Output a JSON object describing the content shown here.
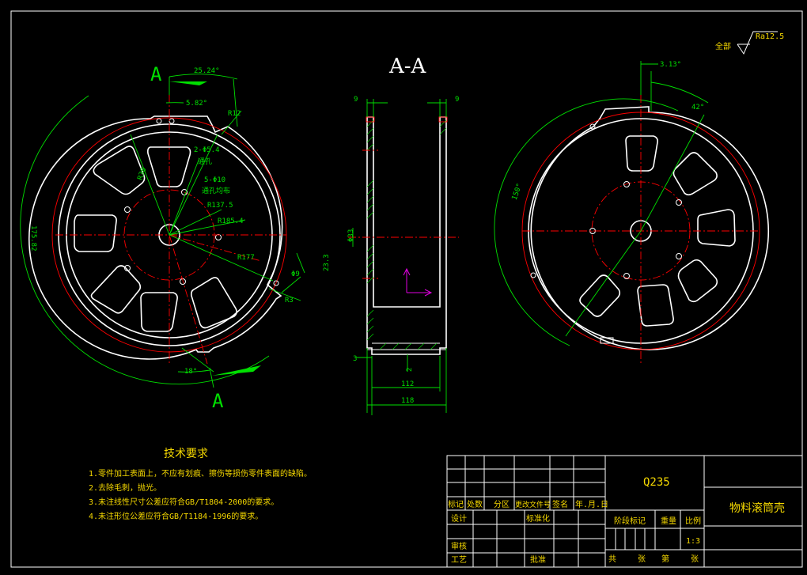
{
  "section_title": "A-A",
  "section_mark": "A",
  "surface_finish": {
    "label": "全部",
    "value": "Ra12.5"
  },
  "left_view": {
    "dims": {
      "ang_top": "25.24°",
      "ang_small": "5.82°",
      "r_top": "R12",
      "holes_small": "2-Φ5.4",
      "holes_small_note": "通孔",
      "holes_main": "5-Φ10",
      "holes_main_note": "通孔均布",
      "r_inner": "R30",
      "r1": "R137.5",
      "r2": "R185.4",
      "r3": "R177",
      "phi_small": "Φ9",
      "r_side": "R3",
      "len_side": "23.3",
      "dia_left": "175.82",
      "ang_bottom": "18°"
    }
  },
  "section_view": {
    "dims": {
      "top_left": "9",
      "top_right": "9",
      "bore": "Φ33",
      "bottom_thk": "3",
      "gap": "2",
      "w1": "112",
      "w2": "118"
    }
  },
  "right_view": {
    "dims": {
      "ang_top": "3.13°",
      "ang_mid": "42°",
      "ang_big": "150°"
    }
  },
  "tech_req": {
    "title": "技术要求",
    "items": [
      "1.零件加工表面上，不应有划痕、擦伤等损伤零件表面的缺陷。",
      "2.去除毛刺，抛光。",
      "3.未注线性尺寸公差应符合GB/T1804-2000的要求。",
      "4.未注形位公差应符合GB/T1184-1996的要求。"
    ]
  },
  "title_block": {
    "material": "Q235",
    "part_name": "物料滚筒壳",
    "h_biaoji": "标记",
    "h_chushu": "处数",
    "h_fenqu": "分区",
    "h_gengai": "更改文件号",
    "h_qianming": "签名",
    "h_date": "年.月.日",
    "sheji": "设计",
    "biaozhunhua": "标准化",
    "jieduan": "阶段标记",
    "zhongliang": "重量",
    "bili": "比例",
    "scale": "1:3",
    "shenhe": "审核",
    "gongyi": "工艺",
    "pizhun": "批准",
    "gong": "共",
    "zhang1": "张",
    "di": "第",
    "zhang2": "张"
  }
}
